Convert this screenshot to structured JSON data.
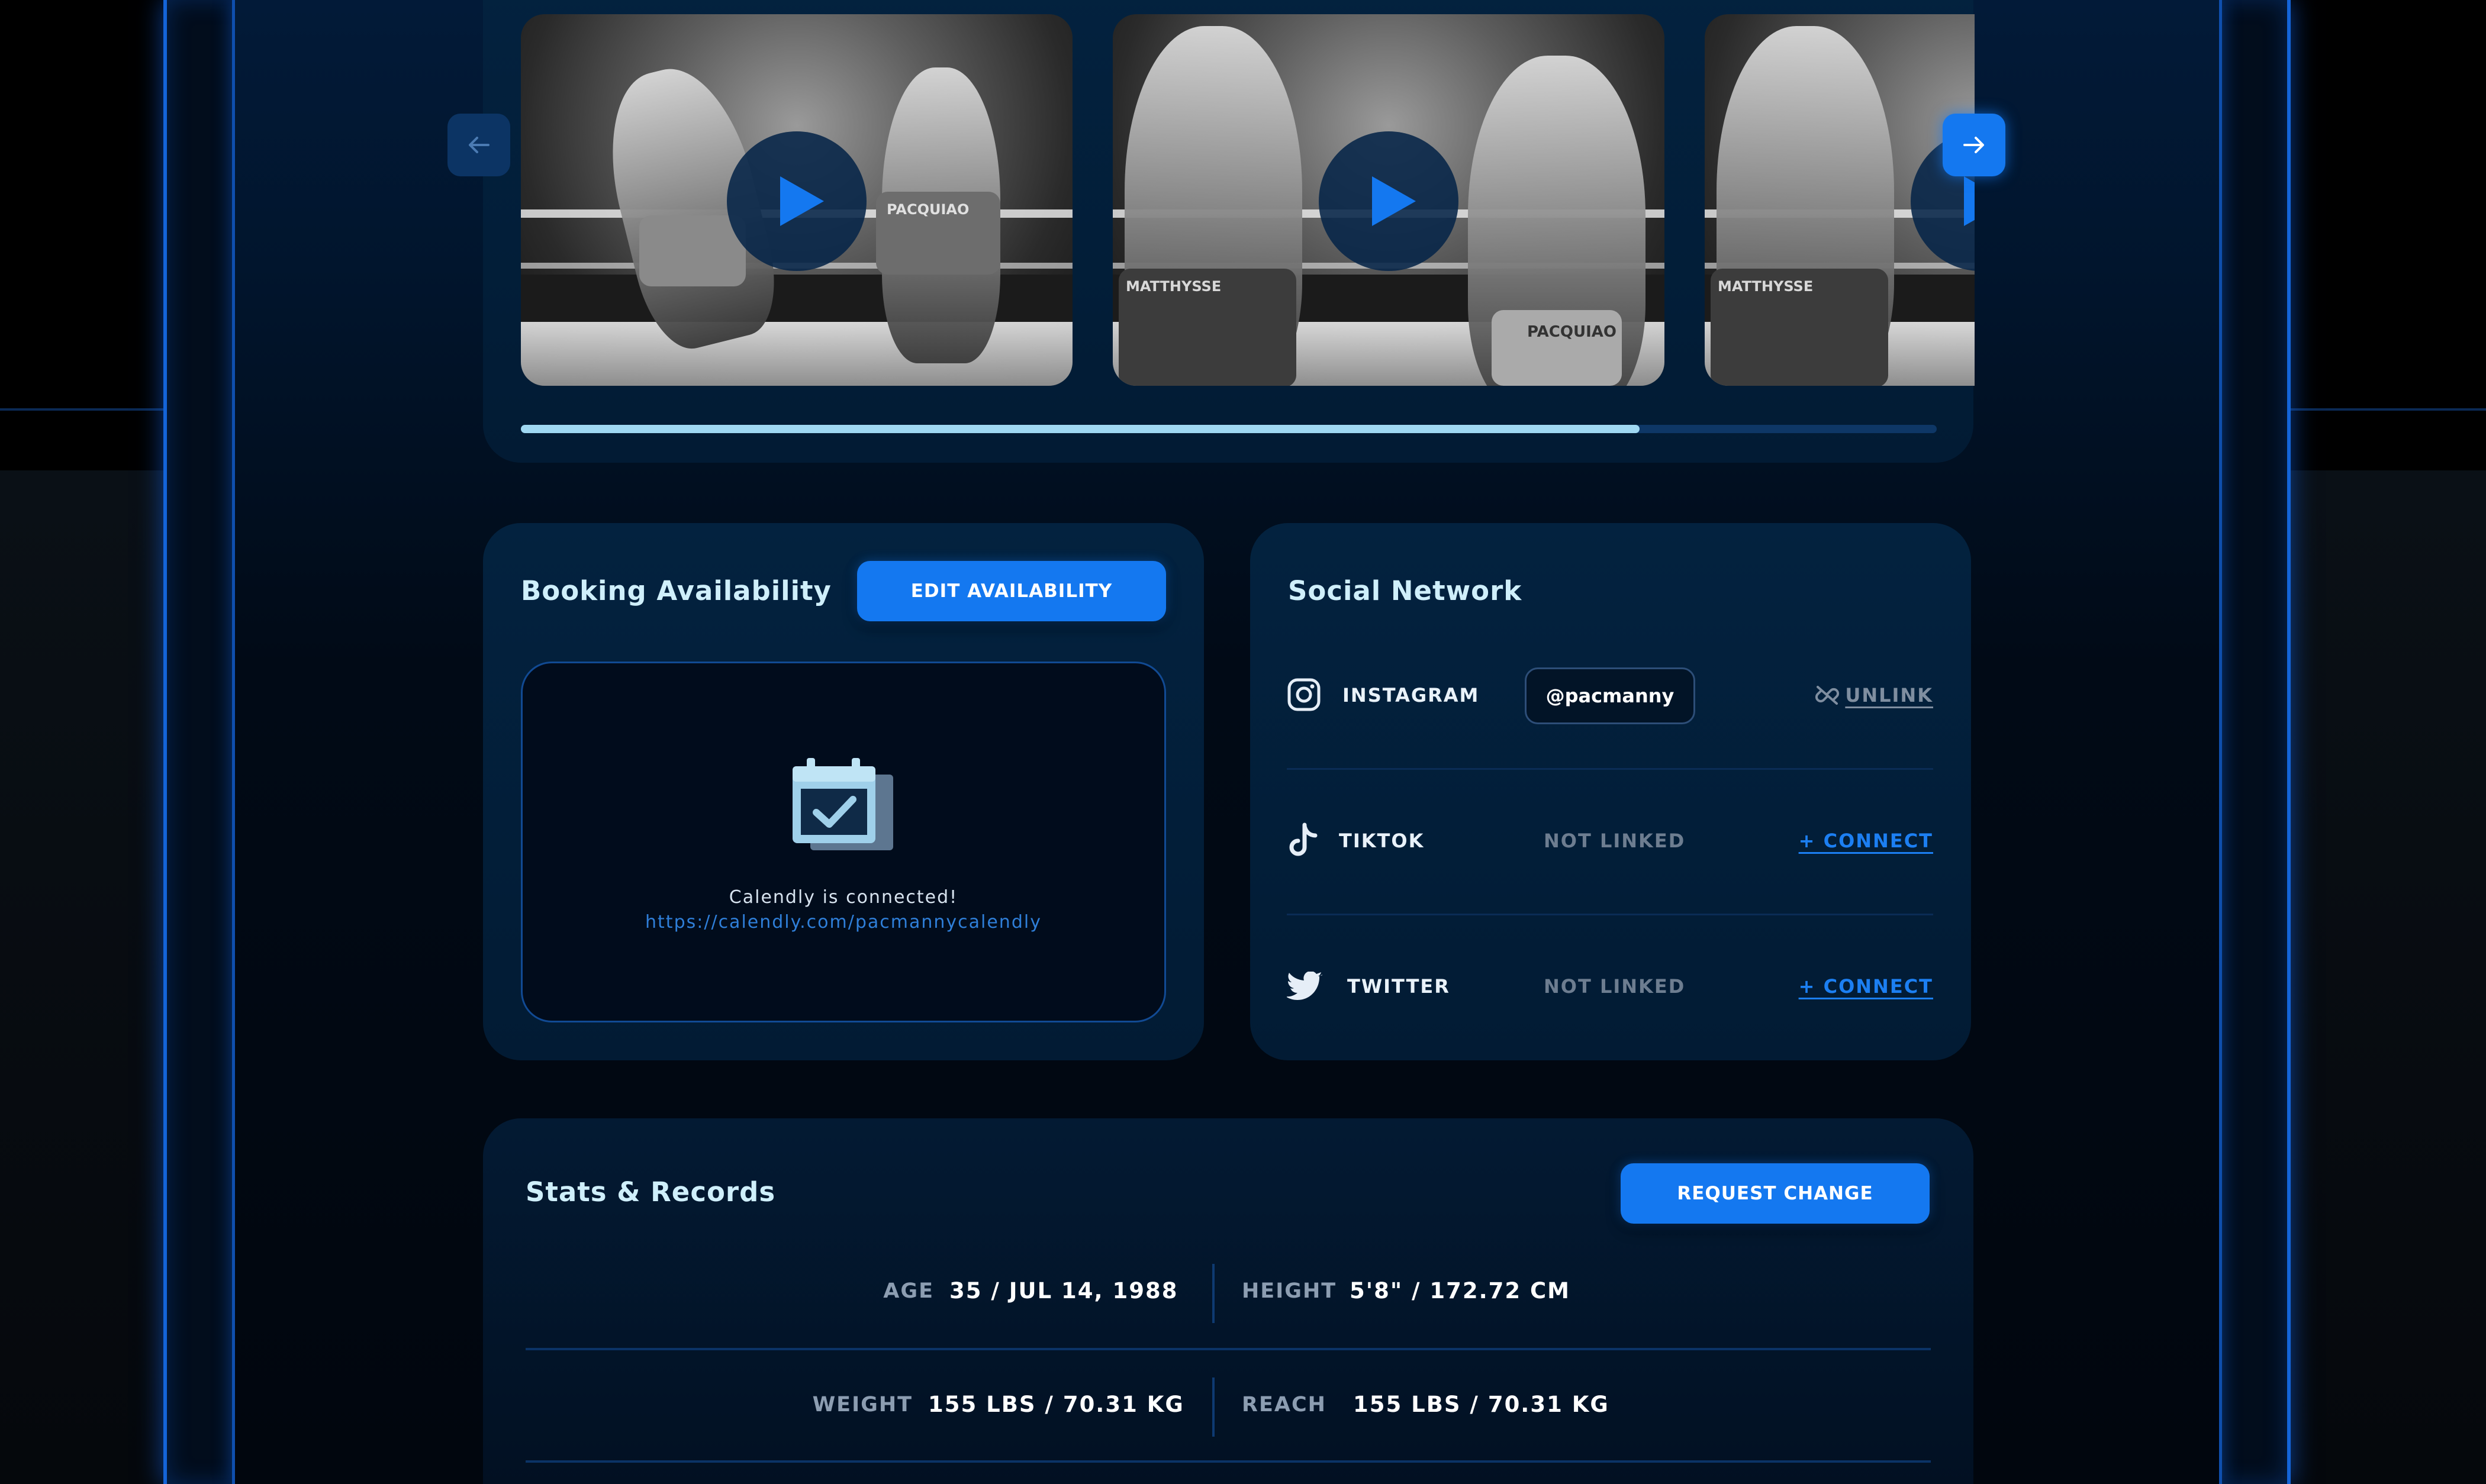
{
  "colors": {
    "accent": "#1478f0",
    "title_text": "#cfeffb",
    "muted_text": "#6d7d90",
    "link": "#1c7ff2",
    "card_bg": "#03223f",
    "progress_fill": "#9fd8f2"
  },
  "videos": {
    "prev_icon": "arrow-left-icon",
    "next_icon": "arrow-right-icon",
    "items": [
      {
        "play_icon": "play-icon",
        "trunks_text": "PACQUIAO"
      },
      {
        "play_icon": "play-icon",
        "trunks_text": "PACQUIAO",
        "opponent_trunks_text": "MATTHYSSE"
      },
      {
        "play_icon": "play-icon",
        "opponent_trunks_text": "MATTHYSSE"
      }
    ],
    "progress_percent": 79
  },
  "booking": {
    "title": "Booking Availability",
    "edit_label": "EDIT AVAILABILITY",
    "status_icon": "calendar-check-icon",
    "status_text": "Calendly is connected!",
    "link": "https://calendly.com/pacmannycalendly"
  },
  "social": {
    "title": "Social Network",
    "rows": [
      {
        "icon": "instagram-icon",
        "name": "INSTAGRAM",
        "handle": "@pacmanny",
        "action": "UNLINK",
        "action_icon": "unlink-icon"
      },
      {
        "icon": "tiktok-icon",
        "name": "TIKTOK",
        "status": "NOT LINKED",
        "action": "+ CONNECT"
      },
      {
        "icon": "twitter-icon",
        "name": "TWITTER",
        "status": "NOT LINKED",
        "action": "+ CONNECT"
      }
    ]
  },
  "stats": {
    "title": "Stats & Records",
    "request_label": "REQUEST CHANGE",
    "rows": [
      [
        {
          "label": "AGE",
          "value": "35 / JUL 14, 1988"
        },
        {
          "label": "HEIGHT",
          "value": "5'8\" / 172.72 CM"
        }
      ],
      [
        {
          "label": "WEIGHT",
          "value": "155 LBS / 70.31 KG"
        },
        {
          "label": "REACH",
          "value": "155 LBS / 70.31 KG"
        }
      ]
    ]
  }
}
